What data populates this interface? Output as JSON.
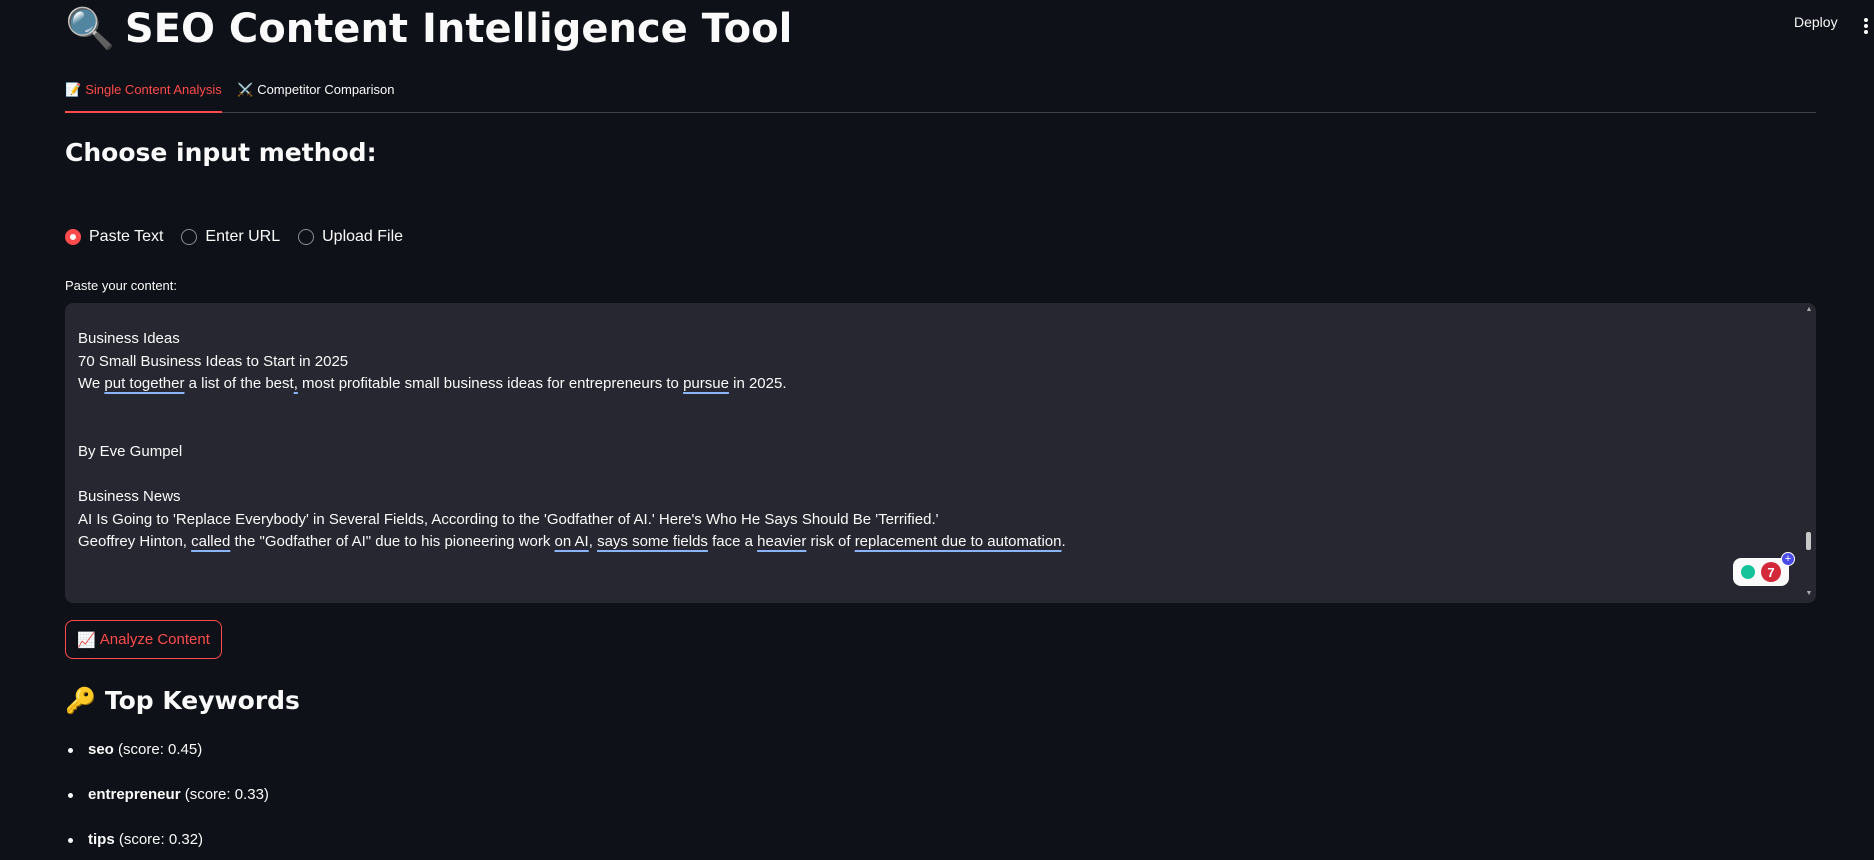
{
  "header": {
    "title_emoji": "🔍",
    "title": "SEO Content Intelligence Tool",
    "deploy_label": "Deploy",
    "menu_icon": "more-vertical-icon"
  },
  "tabs": [
    {
      "emoji": "📝",
      "label": "Single Content Analysis",
      "active": true
    },
    {
      "emoji": "⚔️",
      "label": "Competitor Comparison",
      "active": false
    }
  ],
  "input_method": {
    "heading": "Choose input method:",
    "options": [
      {
        "label": "Paste Text",
        "selected": true
      },
      {
        "label": "Enter URL",
        "selected": false
      },
      {
        "label": "Upload File",
        "selected": false
      }
    ]
  },
  "content_field": {
    "label": "Paste your content:",
    "lines": [
      "Business Ideas",
      "70 Small Business Ideas to Start in 2025",
      "We put together a list of the best, most profitable small business ideas for entrepreneurs to pursue in 2025.",
      "",
      "",
      "By Eve Gumpel",
      "",
      "Business News",
      "AI Is Going to 'Replace Everybody' in Several Fields, According to the 'Godfather of AI.' Here's Who He Says Should Be 'Terrified.'",
      "Geoffrey Hinton, called the \"Godfather of AI\" due to his pioneering work on AI, says some fields face a heavier risk of replacement due to automation."
    ],
    "grammar_issue_count": "7"
  },
  "analyze_button": {
    "emoji": "📈",
    "label": "Analyze Content"
  },
  "keywords_section": {
    "heading_emoji": "🔑",
    "heading": "Top Keywords",
    "items": [
      {
        "term": "seo",
        "score": "(score: 0.45)"
      },
      {
        "term": "entrepreneur",
        "score": "(score: 0.33)"
      },
      {
        "term": "tips",
        "score": "(score: 0.32)"
      }
    ]
  },
  "colors": {
    "background": "#0e1117",
    "accent": "#ff4b4b",
    "input_bg": "#262730",
    "text": "#fafafa"
  }
}
